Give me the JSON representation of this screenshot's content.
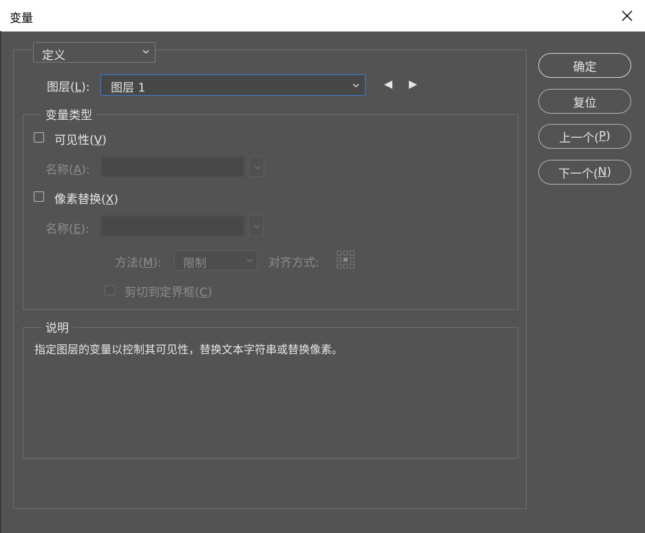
{
  "window": {
    "title": "变量",
    "close_icon": "close-icon"
  },
  "mode": {
    "selected": "定义"
  },
  "layer": {
    "label": "图层(",
    "label_key": "L",
    "label_end": "):",
    "selected": "图层 1"
  },
  "variable_type": {
    "title": "变量类型",
    "visibility": {
      "label": "可见性(",
      "key": "V",
      "end": ")",
      "checked": false
    },
    "name_a": {
      "label": "名称(",
      "key": "A",
      "end": "):",
      "value": ""
    },
    "pixel_replace": {
      "label": "像素替换(",
      "key": "X",
      "end": ")",
      "checked": false
    },
    "name_e": {
      "label": "名称(",
      "key": "E",
      "end": "):",
      "value": ""
    },
    "method": {
      "label": "方法(",
      "key": "M",
      "end": "):",
      "selected": "限制"
    },
    "alignment": {
      "label": "对齐方式:"
    },
    "clip": {
      "label": "剪切到定界框(",
      "key": "C",
      "end": ")",
      "checked": false
    }
  },
  "description": {
    "title": "说明",
    "text": "指定图层的变量以控制其可见性，替换文本字符串或替换像素。"
  },
  "buttons": {
    "ok": "确定",
    "reset": "复位",
    "prev_label": "上一个(",
    "prev_key": "P",
    "prev_end": ")",
    "next_label": "下一个(",
    "next_key": "N",
    "next_end": ")"
  },
  "colors": {
    "background": "#535353",
    "focus": "#3a7bd5"
  }
}
